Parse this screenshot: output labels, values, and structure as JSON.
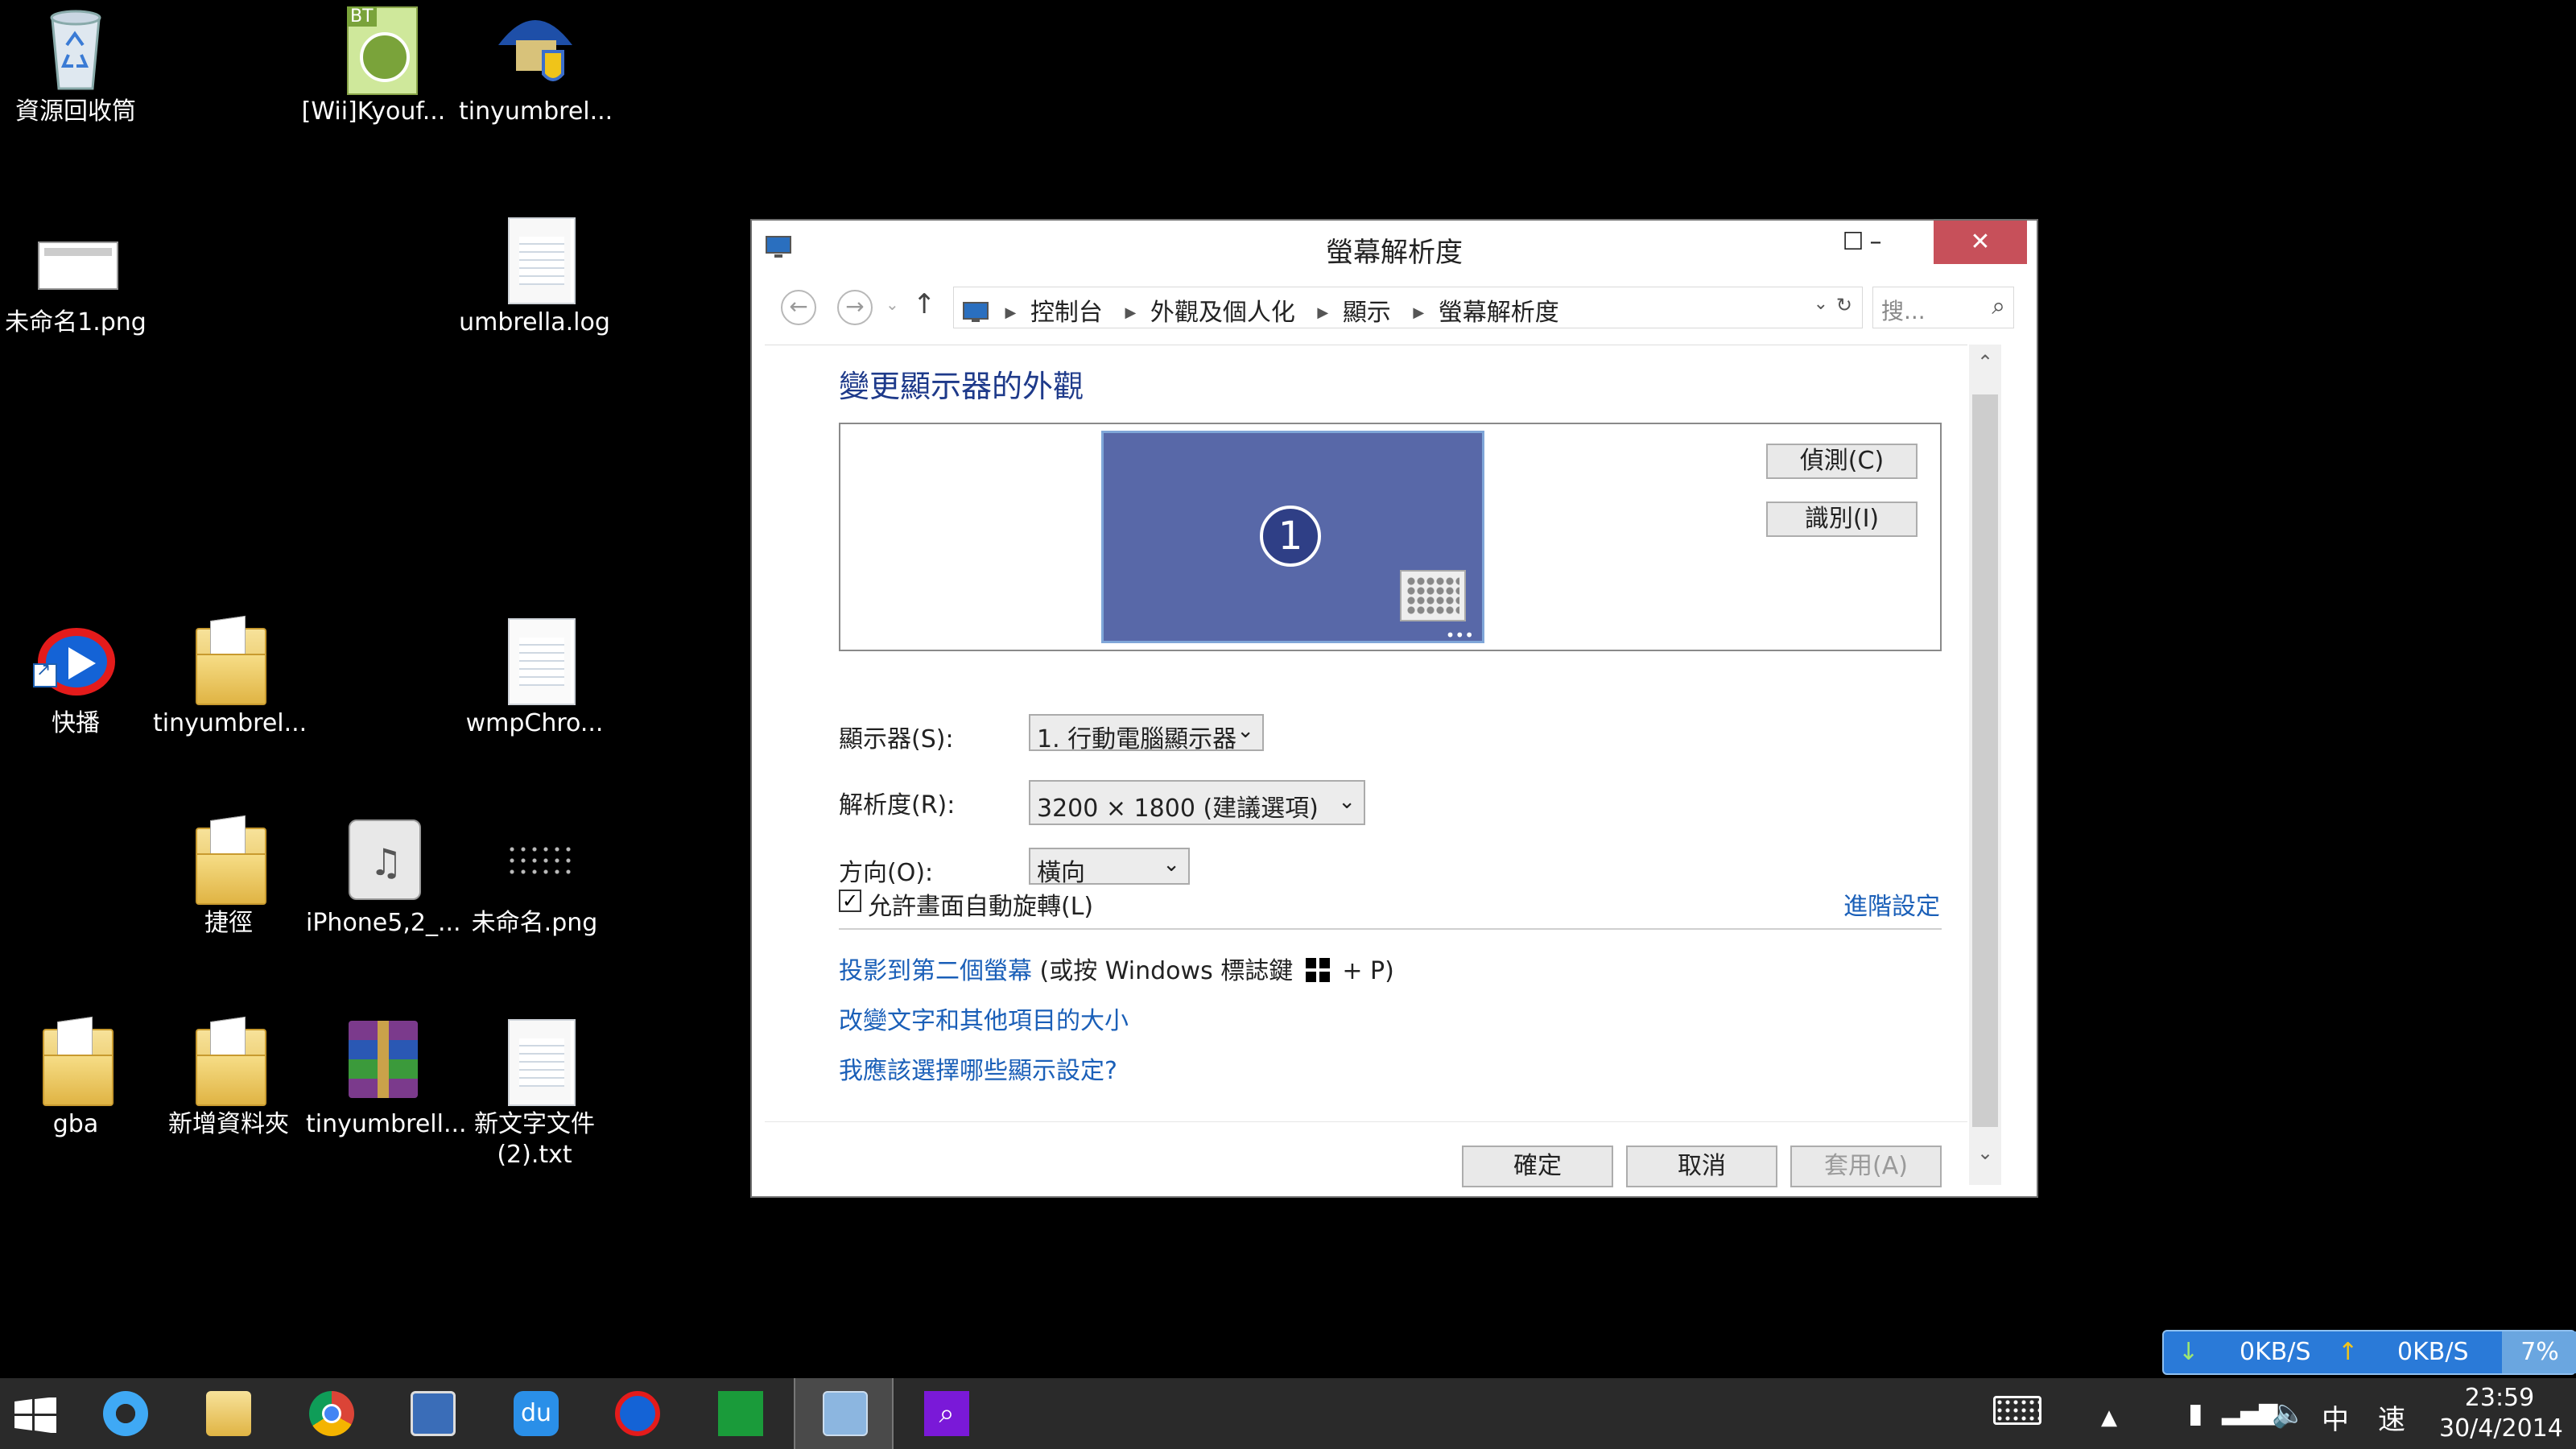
{
  "desktop": {
    "icons": [
      {
        "label": "資源回收筒"
      },
      {
        "label": "[Wii]Kyouf..."
      },
      {
        "label": "tinyumbrel..."
      },
      {
        "label": "未命名1.png"
      },
      {
        "label": "umbrella.log"
      },
      {
        "label": "快播"
      },
      {
        "label": "tinyumbrel..."
      },
      {
        "label": "wmpChro..."
      },
      {
        "label": "捷徑"
      },
      {
        "label": "iPhone5,2_..."
      },
      {
        "label": "未命名.png"
      },
      {
        "label": "gba"
      },
      {
        "label": "新增資料夾"
      },
      {
        "label": "tinyumbrell..."
      },
      {
        "label": "新文字文件\n(2).txt"
      }
    ]
  },
  "window": {
    "title": "螢幕解析度",
    "controls": {
      "minimize": "–",
      "maximize": "☐",
      "close": "✕"
    },
    "breadcrumbs": [
      "控制台",
      "外觀及個人化",
      "顯示",
      "螢幕解析度"
    ],
    "search_placeholder": "搜...",
    "heading": "變更顯示器的外觀",
    "monitor_number": "1",
    "detect_button": "偵測(C)",
    "identify_button": "識別(I)",
    "display_label": "顯示器(S):",
    "display_value": "1. 行動電腦顯示器",
    "resolution_label": "解析度(R):",
    "resolution_value": "3200 × 1800 (建議選項)",
    "orientation_label": "方向(O):",
    "orientation_value": "橫向",
    "autorotate_label": "允許畫面自動旋轉(L)",
    "autorotate_checked": true,
    "advanced_link": "進階設定",
    "project_link": "投影到第二個螢幕",
    "project_hint_pre": "(或按 Windows 標誌鍵",
    "project_hint_post": "+ P)",
    "text_size_link": "改變文字和其他項目的大小",
    "which_settings_link": "我應該選擇哪些顯示設定?",
    "ok_button": "確定",
    "cancel_button": "取消",
    "apply_button": "套用(A)"
  },
  "speed_widget": {
    "down": "0KB/S",
    "up": "0KB/S",
    "percent": "7%"
  },
  "taskbar": {
    "apps": [
      "start",
      "internet-explorer",
      "file-explorer",
      "chrome",
      "lenovo-display",
      "baidu",
      "qvod",
      "store",
      "control-panel",
      "search"
    ],
    "ime": "中",
    "speed_char": "速",
    "time": "23:59",
    "date": "30/4/2014"
  },
  "colors": {
    "accent": "#1e3a8a",
    "link": "#1a5fb8",
    "close": "#c7505a",
    "monitor": "#5868a8"
  }
}
